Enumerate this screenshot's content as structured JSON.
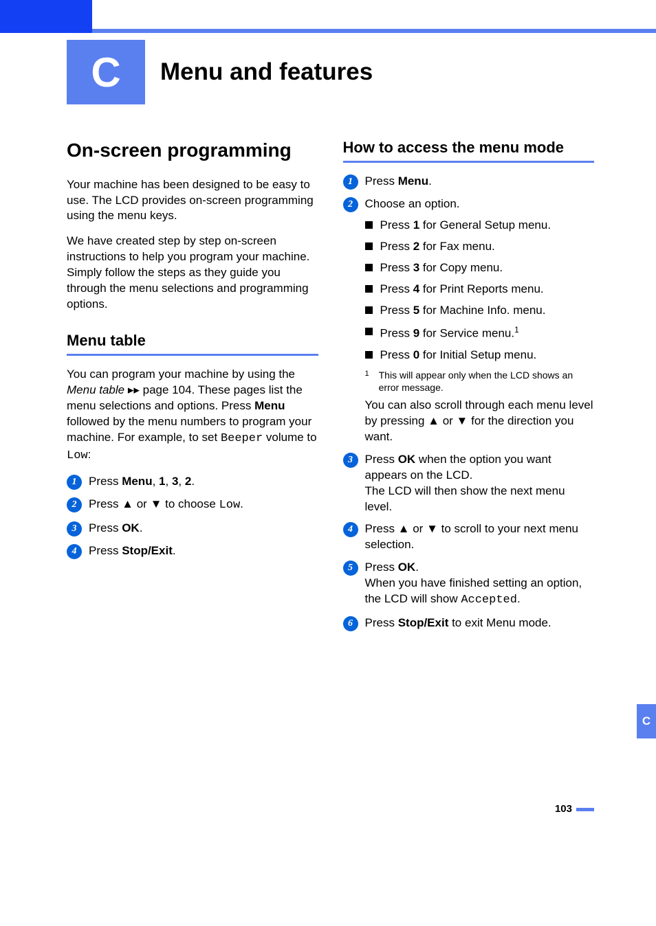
{
  "appendix": {
    "letter": "C",
    "title": "Menu and features"
  },
  "left": {
    "h1": "On-screen programming",
    "para1": "Your machine has been designed to be easy to use. The LCD provides on-screen programming using the menu keys.",
    "para2": "We have created step by step on-screen instructions to help you program your machine. Simply follow the steps as they guide you through the menu selections and programming options.",
    "h2": "Menu table",
    "mt_para_pre": "You can program your machine by using the ",
    "mt_link": "Menu table",
    "mt_arrows": " ▸▸ ",
    "mt_pageref": "page 104",
    "mt_para_mid": ". These pages list the menu selections and options. Press ",
    "mt_menu": "Menu",
    "mt_para_post": " followed by the menu numbers to program your machine. For example, to set ",
    "mt_beeper": "Beeper",
    "mt_vol_to": " volume to ",
    "mt_low": "Low",
    "steps": [
      {
        "num": "1",
        "pre": "Press ",
        "strong": "Menu",
        "mid": ", ",
        "bold2": "1",
        "mid2": ", ",
        "bold3": "3",
        "mid3": ", ",
        "bold4": "2",
        "post": "."
      },
      {
        "num": "2",
        "pre": "Press ▲ or ▼ to choose ",
        "mono": "Low",
        "post": "."
      },
      {
        "num": "3",
        "pre": "Press ",
        "strong": "OK",
        "post": "."
      },
      {
        "num": "4",
        "pre": "Press ",
        "strong": "Stop/Exit",
        "post": "."
      }
    ]
  },
  "right": {
    "h1": "How to access the menu mode",
    "steps": [
      {
        "num": "1",
        "pre": "Press ",
        "strong": "Menu",
        "post": "."
      },
      {
        "num": "2",
        "pre": "Choose an option.",
        "bullets": [
          {
            "pre": "Press ",
            "bold": "1",
            "post": " for General Setup menu."
          },
          {
            "pre": "Press ",
            "bold": "2",
            "post": " for Fax menu."
          },
          {
            "pre": "Press ",
            "bold": "3",
            "post": " for Copy menu."
          },
          {
            "pre": "Press ",
            "bold": "4",
            "post": " for Print Reports menu."
          },
          {
            "pre": "Press ",
            "bold": "5",
            "post": " for Machine Info. menu."
          },
          {
            "pre": "Press ",
            "bold": "9",
            "post": " for Service menu.",
            "sup": "1"
          },
          {
            "pre": "Press ",
            "bold": "0",
            "post": " for Initial Setup menu."
          }
        ],
        "footnote": {
          "ref": "1",
          "text": "This will appear only when the LCD shows an error message."
        },
        "tail": "You can also scroll through each menu level by pressing ▲ or ▼ for the direction you want."
      },
      {
        "num": "3",
        "pre": "Press ",
        "strong": "OK",
        "mid": " when the option you want appears on the LCD.",
        "tail": "The LCD will then show the next menu level."
      },
      {
        "num": "4",
        "pre": "Press ▲ or ▼ to scroll to your next menu selection."
      },
      {
        "num": "5",
        "pre": "Press ",
        "strong": "OK",
        "post": ".",
        "tail_pre": "When you have finished setting an option, the LCD will show ",
        "tail_mono": "Accepted",
        "tail_post": "."
      },
      {
        "num": "6",
        "pre": "Press ",
        "strong": "Stop/Exit",
        "post": " to exit Menu mode."
      }
    ]
  },
  "sidetab": "C",
  "page": "103"
}
